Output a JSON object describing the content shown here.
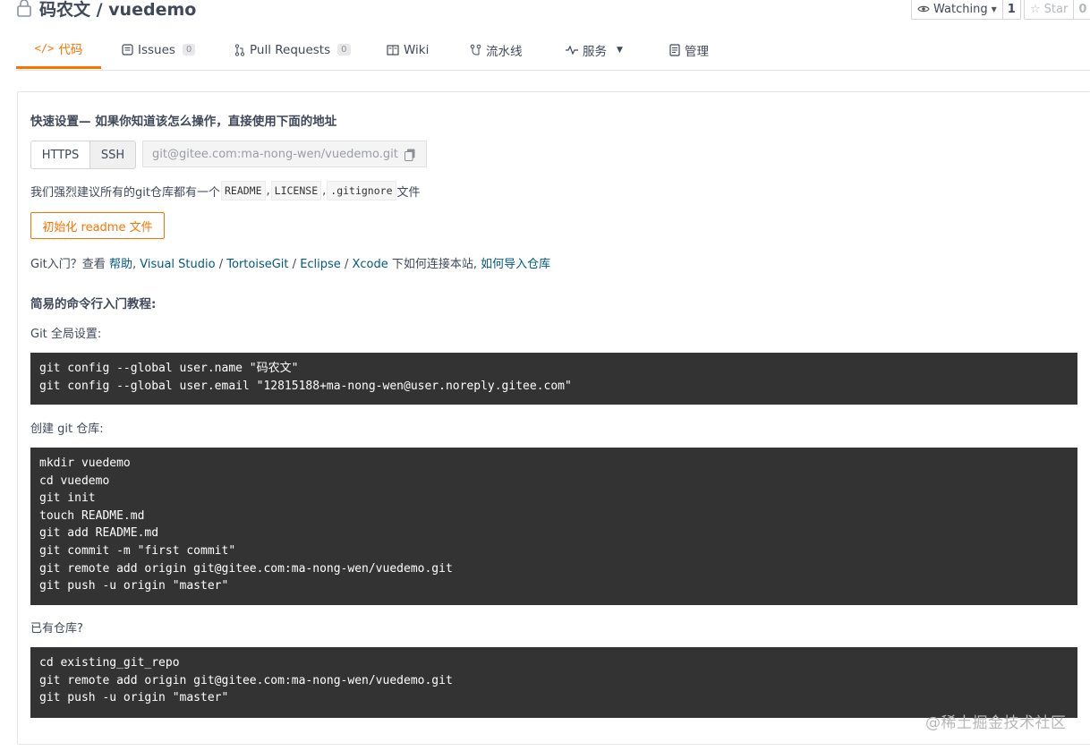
{
  "header": {
    "repo_title": "码农文 / vuedemo",
    "watch_label": "Watching",
    "watch_count": "1",
    "star_label": "Star",
    "star_count": "0"
  },
  "tabs": [
    {
      "label": "代码",
      "count": null,
      "icon": "code-icon",
      "active": true
    },
    {
      "label": "Issues",
      "count": "0",
      "icon": "issues-icon"
    },
    {
      "label": "Pull Requests",
      "count": "0",
      "icon": "pull-request-icon"
    },
    {
      "label": "Wiki",
      "count": null,
      "icon": "book-icon"
    },
    {
      "label": "流水线",
      "count": null,
      "icon": "pipeline-icon"
    },
    {
      "label": "服务",
      "count": null,
      "icon": "pulse-icon"
    },
    {
      "label": "管理",
      "count": null,
      "icon": "manage-icon"
    }
  ],
  "quick_setup": {
    "heading": "快速设置— 如果你知道该怎么操作，直接使用下面的地址",
    "https_label": "HTTPS",
    "ssh_label": "SSH",
    "url": "git@gitee.com:ma-nong-wen/vuedemo.git",
    "recommend_prefix": "我们强烈建议所有的git仓库都有一个",
    "readme": "README",
    "license": "LICENSE",
    "gitignore": ".gitignore",
    "comma1": ",",
    "comma2": ",",
    "recommend_suffix": "文件",
    "init_button": "初始化 readme 文件"
  },
  "help": {
    "prefix": "Git入门？查看",
    "help_link": "帮助",
    "sep1": ",",
    "vs_link": "Visual Studio",
    "slash1": "/",
    "tortoise_link": "TortoiseGit",
    "slash2": "/",
    "eclipse_link": "Eclipse",
    "slash3": "/",
    "xcode_link": "Xcode",
    "middle": "下如何连接本站,",
    "import_link": "如何导入仓库"
  },
  "tutorial": {
    "heading": "简易的命令行入门教程:",
    "global_label": "Git 全局设置:",
    "global_code": [
      "git config --global user.name \"码农文\"",
      "git config --global user.email \"12815188+ma-nong-wen@user.noreply.gitee.com\""
    ],
    "create_label": "创建 git 仓库:",
    "create_code": [
      "mkdir vuedemo",
      "cd vuedemo",
      "git init",
      "touch README.md",
      "git add README.md",
      "git commit -m \"first commit\"",
      "git remote add origin git@gitee.com:ma-nong-wen/vuedemo.git",
      "git push -u origin \"master\""
    ],
    "existing_label": "已有仓库?",
    "existing_code": [
      "cd existing_git_repo",
      "git remote add origin git@gitee.com:ma-nong-wen/vuedemo.git",
      "git push -u origin \"master\""
    ]
  },
  "watermark": "@稀土掘金技术社区",
  "colors": {
    "accent": "#fe7300",
    "link": "#005980",
    "code_bg": "#333333"
  }
}
